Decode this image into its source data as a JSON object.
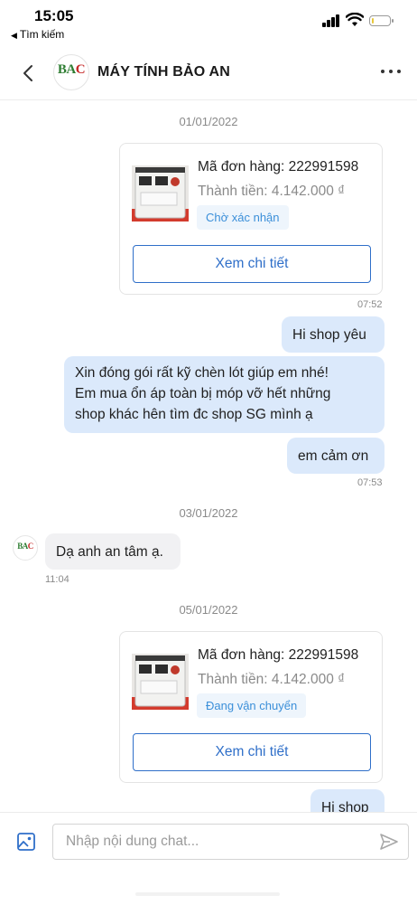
{
  "status_bar": {
    "time": "15:05",
    "back_app": "Tìm kiếm",
    "battery_level": 0.12,
    "battery_color": "#e8c83a"
  },
  "header": {
    "shop_name": "MÁY TÍNH BẢO AN",
    "logo_text_left": "BA",
    "logo_text_right": "C"
  },
  "chat": {
    "date_1": "01/01/2022",
    "order_1": {
      "code": "Mã đơn hàng: 222991598",
      "total": "Thành tiền: 4.142.000 ₫",
      "status": "Chờ xác nhận",
      "detail_label": "Xem chi tiết",
      "time": "07:52"
    },
    "msg_hi": "Hi shop yêu",
    "msg_long_1": "Xin đóng gói rất kỹ chèn lót giúp em nhé!",
    "msg_long_2": "Em mua ổn áp toàn bị móp vỡ hết những",
    "msg_long_3": "shop khác hên tìm đc shop SG mình ạ",
    "msg_thanks": "em cảm ơn",
    "time_753": "07:53",
    "date_2": "03/01/2022",
    "reply": "Dạ anh an tâm ạ.",
    "reply_time": "11:04",
    "date_3": "05/01/2022",
    "order_2": {
      "code": "Mã đơn hàng: 222991598",
      "total": "Thành tiền: 4.142.000 ₫",
      "status": "Đang vận chuyển",
      "detail_label": "Xem chi tiết"
    },
    "msg_partial": "Hi shop"
  },
  "input": {
    "placeholder": "Nhập nội dung chat..."
  },
  "colors": {
    "accent": "#2f6fc9",
    "bubble_out": "#dbe9fb",
    "bubble_in": "#f1f1f3",
    "status_badge_bg": "#eef5fc",
    "status_badge_text": "#3b8fd9"
  },
  "icons": [
    "chevron-left-icon",
    "more-horizontal-icon",
    "image-icon",
    "send-icon",
    "signal-icon",
    "wifi-icon",
    "battery-icon"
  ]
}
